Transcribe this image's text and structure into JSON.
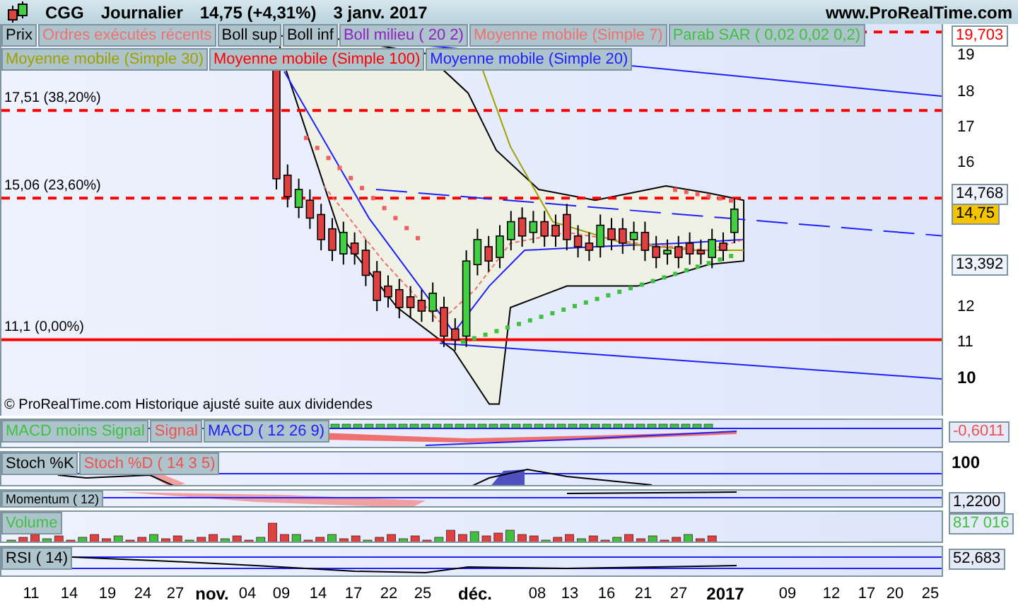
{
  "header": {
    "symbol": "CGG",
    "period": "Journalier",
    "price": "14,75 (+4,31%)",
    "date": "3 janv. 2017",
    "site": "www.ProRealTime.com"
  },
  "price_panel": {
    "legend_rows": [
      [
        {
          "label": "Prix",
          "color": "#000000"
        },
        {
          "label": "Ordres exécutés récents",
          "color": "#f07070"
        },
        {
          "label": "Boll sup",
          "color": "#000000"
        },
        {
          "label": "Boll inf",
          "color": "#000000"
        },
        {
          "label": "Boll milieu ( 20 2)",
          "color": "#9020c0"
        },
        {
          "label": "Moyenne mobile (Simple 7)",
          "color": "#f07070"
        },
        {
          "label": "Parab SAR ( 0,02 0,02 0,2)",
          "color": "#40c040"
        }
      ],
      [
        {
          "label": "Moyenne mobile (Simple 30)",
          "color": "#a0a000"
        },
        {
          "label": "Moyenne mobile (Simple 100)",
          "color": "#ff0000"
        },
        {
          "label": "Moyenne mobile (Simple 20)",
          "color": "#2020ff"
        }
      ]
    ],
    "levels": [
      {
        "label": "17,51 (38,20%)"
      },
      {
        "label": "15,06 (23,60%)"
      },
      {
        "label": "11,1 (0,00%)"
      }
    ],
    "axis_ticks": [
      {
        "label": "19",
        "major": false
      },
      {
        "label": "18",
        "major": false
      },
      {
        "label": "17",
        "major": false
      },
      {
        "label": "16",
        "major": false
      },
      {
        "label": "12",
        "major": false
      },
      {
        "label": "11",
        "major": false
      },
      {
        "label": "10",
        "major": true
      }
    ],
    "axis_badges": [
      {
        "label": "19,703",
        "kind": "high"
      },
      {
        "label": "14,768",
        "kind": "level"
      },
      {
        "label": "14,75",
        "kind": "last"
      },
      {
        "label": "13,392",
        "kind": "level"
      }
    ],
    "footer": "© ProRealTime.com  Historique ajusté suite aux dividendes"
  },
  "indicators": [
    {
      "kind": "macd",
      "legend": [
        {
          "label": "MACD moins Signal",
          "color": "#40c040"
        },
        {
          "label": "Signal",
          "color": "#f05050"
        },
        {
          "label": "MACD ( 12 26 9)",
          "color": "#2020ff"
        }
      ],
      "axis_label": "-0,6011"
    },
    {
      "kind": "stoch",
      "legend": [
        {
          "label": "Stoch %K",
          "color": "#000000"
        },
        {
          "label": "Stoch %D ( 14 3 5)",
          "color": "#f05050"
        }
      ],
      "axis_label": "100"
    },
    {
      "kind": "momentum",
      "legend": [
        {
          "label": "Momentum ( 12)",
          "color": "#000000"
        }
      ],
      "axis_label": "1,2200"
    },
    {
      "kind": "volume",
      "legend": [
        {
          "label": "Volume",
          "color": "#40c040"
        }
      ],
      "axis_label": "817 016"
    },
    {
      "kind": "rsi",
      "legend": [
        {
          "label": "RSI ( 14)",
          "color": "#000000"
        }
      ],
      "axis_label": "52,683"
    }
  ],
  "x_axis": [
    {
      "label": "11",
      "major": false
    },
    {
      "label": "14",
      "major": false
    },
    {
      "label": "19",
      "major": false
    },
    {
      "label": "24",
      "major": false
    },
    {
      "label": "27",
      "major": false
    },
    {
      "label": "nov.",
      "major": true
    },
    {
      "label": "04",
      "major": false
    },
    {
      "label": "09",
      "major": false
    },
    {
      "label": "14",
      "major": false
    },
    {
      "label": "17",
      "major": false
    },
    {
      "label": "22",
      "major": false
    },
    {
      "label": "25",
      "major": false
    },
    {
      "label": "déc.",
      "major": true
    },
    {
      "label": "08",
      "major": false
    },
    {
      "label": "13",
      "major": false
    },
    {
      "label": "16",
      "major": false
    },
    {
      "label": "21",
      "major": false
    },
    {
      "label": "27",
      "major": false
    },
    {
      "label": "2017",
      "major": true
    },
    {
      "label": "09",
      "major": false
    },
    {
      "label": "12",
      "major": false
    },
    {
      "label": "17",
      "major": false
    },
    {
      "label": "20",
      "major": false
    },
    {
      "label": "25",
      "major": false
    }
  ]
}
